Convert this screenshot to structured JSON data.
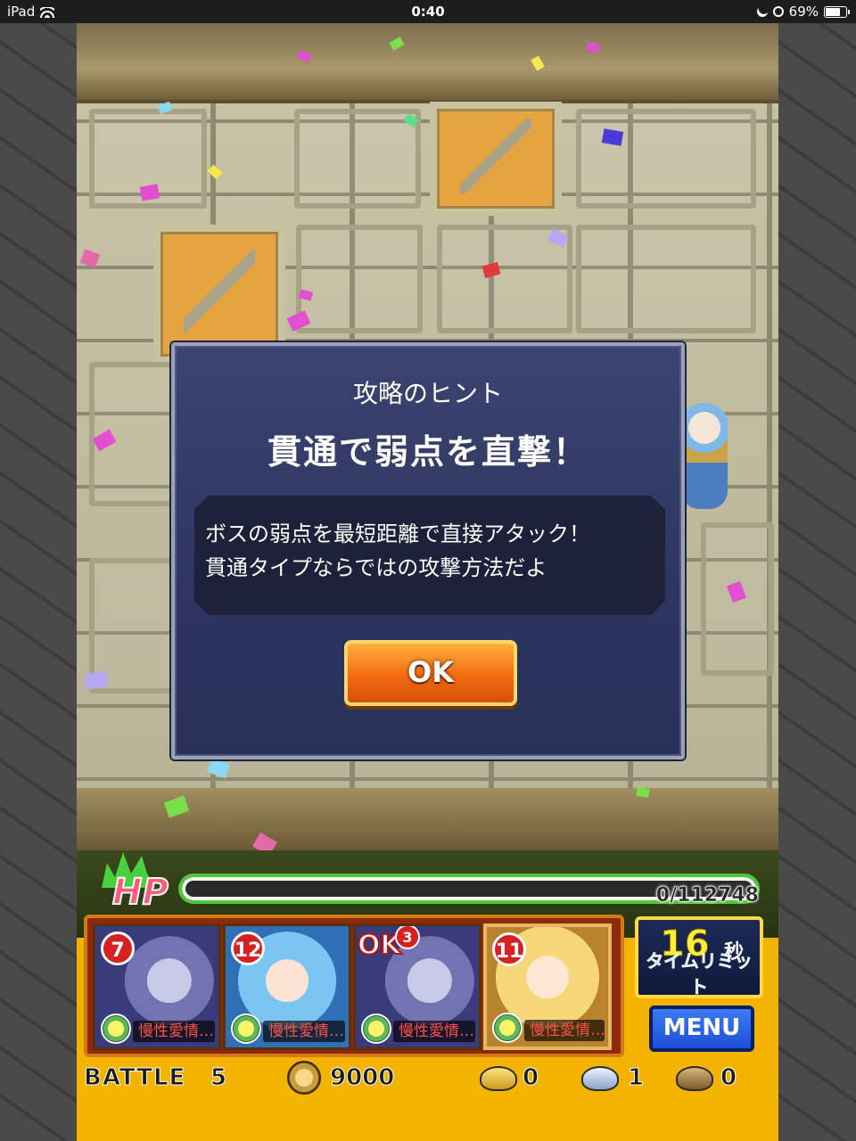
{
  "status_bar": {
    "device": "iPad",
    "time": "0:40",
    "battery": "69%"
  },
  "dialog": {
    "heading": "攻略のヒント",
    "title": "貫通で弱点を直撃！",
    "body_line1": "ボスの弱点を最短距離で直接アタック！",
    "body_line2": "貫通タイプならではの攻撃方法だよ",
    "ok_label": "OK"
  },
  "hud": {
    "hp_label": "HP",
    "hp_value": "0/112748",
    "hp_fraction": 0.0,
    "team": [
      {
        "turn": "7",
        "ability": "慢性愛情…"
      },
      {
        "turn": "12",
        "ability": "慢性愛情…"
      },
      {
        "turn": "OK",
        "sub": "3",
        "ability": "慢性愛情…"
      },
      {
        "turn": "11",
        "ability": "慢性愛情…"
      }
    ],
    "timer_value": "16",
    "timer_unit": "秒",
    "timer_label": "タイムリミット",
    "menu_label": "MENU",
    "battle_label": "BATTLE",
    "battle_number": "5",
    "coins": "9000",
    "gold_chests": "0",
    "silver_chests": "1",
    "bronze_chests": "0"
  },
  "icons": [
    "wifi-icon",
    "moon-icon",
    "orientation-lock-icon",
    "battery-icon",
    "coin-icon",
    "gold-chest-icon",
    "silver-chest-icon",
    "bronze-chest-icon"
  ],
  "colors": {
    "dialog_bg": "#2d3560",
    "ok_button": "#f36a10",
    "hud_bg": "#f4b400",
    "menu_button": "#1d4ed8",
    "hp_border": "#4ec83a"
  }
}
